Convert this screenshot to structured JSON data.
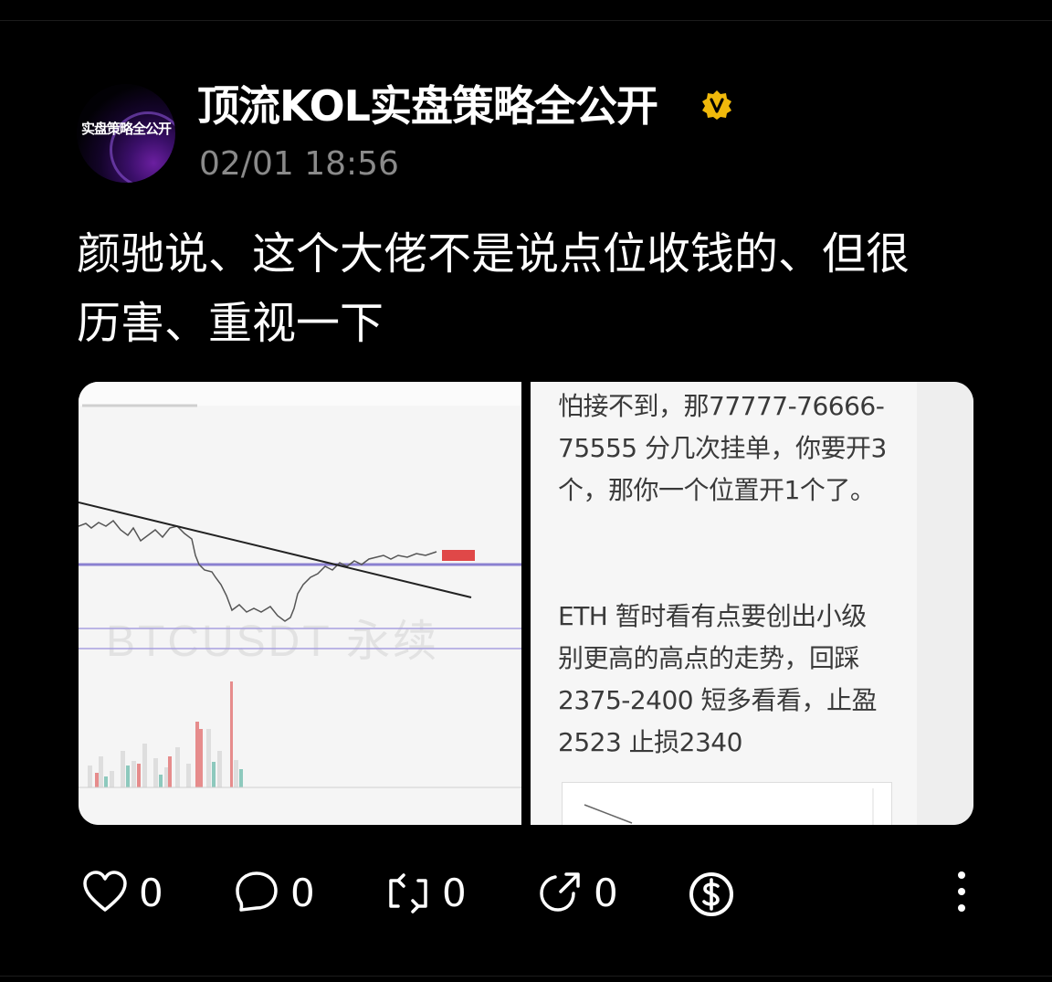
{
  "post": {
    "author_name": "顶流KOL实盘策略全公开",
    "avatar_text": "实盘策略全公开",
    "timestamp": "02/01 18:56",
    "text_lines": [
      "颜驰说、这个大佬不是说点位收钱的、但很",
      "历害、重视一下"
    ]
  },
  "images": {
    "chart_watermark": "BTCUSDT 永续",
    "note_lines_top": [
      "怕接不到，那77777-76666-",
      "75555 分几次挂单，你要开3",
      "个，那你一个位置开1个了。"
    ],
    "note_lines_bottom": [
      "ETH 暂时看有点要创出小级",
      "别更高的高点的走势，回踩",
      "2375-2400 短多看看，止盈",
      "2523  止损2340"
    ]
  },
  "actions": {
    "like_count": "0",
    "comment_count": "0",
    "repost_count": "0",
    "share_count": "0"
  },
  "icons": {
    "verified": "verified-badge-icon",
    "like": "heart-icon",
    "comment": "comment-bubble-icon",
    "repost": "repost-icon",
    "share": "share-icon",
    "tip": "dollar-coin-icon",
    "more": "more-vertical-icon"
  },
  "colors": {
    "background": "#000000",
    "verified_badge": "#f0b90b",
    "timestamp": "#8a8a8a"
  }
}
